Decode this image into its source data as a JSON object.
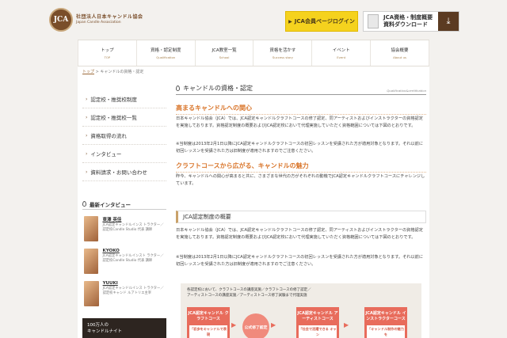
{
  "header": {
    "logo_mark": "JCA",
    "logo_jp": "社団法人日本キャンドル協会",
    "logo_en": "Japan Candle Association",
    "member_login": "JCA会員ページログイン",
    "download_line1": "JCA資格・制度概要",
    "download_line2": "資料ダウンロード"
  },
  "nav": [
    {
      "jp": "トップ",
      "en": "TOP"
    },
    {
      "jp": "資格・認定制度",
      "en": "Qualification"
    },
    {
      "jp": "JCA教室一覧",
      "en": "School"
    },
    {
      "jp": "資格を活かす",
      "en": "Success story"
    },
    {
      "jp": "イベント",
      "en": "Event"
    },
    {
      "jp": "協会概要",
      "en": "About us"
    }
  ],
  "breadcrumb": {
    "home": "トップ",
    "sep": " > ",
    "current": "キャンドルの資格・認定"
  },
  "sidebar": {
    "links": [
      "認定校・推奨校制度",
      "認定校・推奨校一覧",
      "資格取得の流れ",
      "インタビュー",
      "資料請求・お問い合わせ"
    ],
    "interview_title": "最新インタビュー",
    "interviews": [
      {
        "name": "東澤 英佳",
        "desc": "JCA認定キャンドルインス トラクター／認定校Candle Studio 代表 講師"
      },
      {
        "name": "KYOKO",
        "desc": "JCA認定キャンドルインスト ラクター／認定校Candle Studio 代表 講師"
      },
      {
        "name": "YUUKI",
        "desc": "JCA認定キャンドルインス トラクター／認定校キャンド ルアトリエ主宰"
      }
    ],
    "banner_line1": "100万人の",
    "banner_line2": "キャンドルナイト"
  },
  "main": {
    "title": "キャンドルの資格・認定",
    "title_sub": "Qualification&certification",
    "h1": "高まるキャンドルへの関心",
    "p1": "日本キャンドル協会（JCA）では、JCA認定キャンドルクラフトコースの修了認定、同アーティストおよびインストラクターの資格認定を実施しております。資格認定制度の概要およびJCA認定校において代理実施していただく資格範囲については下図のとおりです。",
    "p1b": "※当制度は2013年2月1日以降にJCA認定キャンドルクラフトコースの初回レッスンを受講された方が適用対象となります。それ以前に初回レッスンを受講された方は旧制度が適用されますのでご注意ください。",
    "h2": "クラフトコースから広がる、キャンドルの魅力",
    "p2": "昨今、キャンドルへの関心が高まると共に、さまざまな世代の方がそれぞれの動機でJCA認定キャンドルクラフトコースにチャレンジしています。",
    "box_title": "JCA認定制度の概要",
    "p3": "日本キャンドル協会（JCA）では、JCA認定キャンドルクラフトコースの修了認定、同アーティストおよびインストラクターの資格認定を実施しております。資格認定制度の概要およびJCA認定校において代理実施していただく資格範囲については下図のとおりです。",
    "p3b": "※当制度は2013年2月1日以降にJCA認定キャンドルクラフトコースの初回レッスンを受講された方が適用対象となります。それ以前に初回レッスンを受講された方は旧制度が適用されますのでご注意ください。",
    "diagram": {
      "caption1": "各認定校において、クラフトコースの講座実施／クラフトコースの修了認定／",
      "caption2": "アーティストコースの講座実施／アーティストコース修了試験まで代理実施",
      "box1": "JCA認定キャンドル クラフトコース",
      "box1_inner": "「初歩をキャンドルで表現",
      "circle": "公式修了認定",
      "box2": "JCA認定キャンドル アーティストコース",
      "box2_inner": "「社会で活躍できる キャン",
      "box3": "JCA認定キャンドル インストラクターコース",
      "box3_inner": "「キャンドル制作の魅力を"
    }
  }
}
